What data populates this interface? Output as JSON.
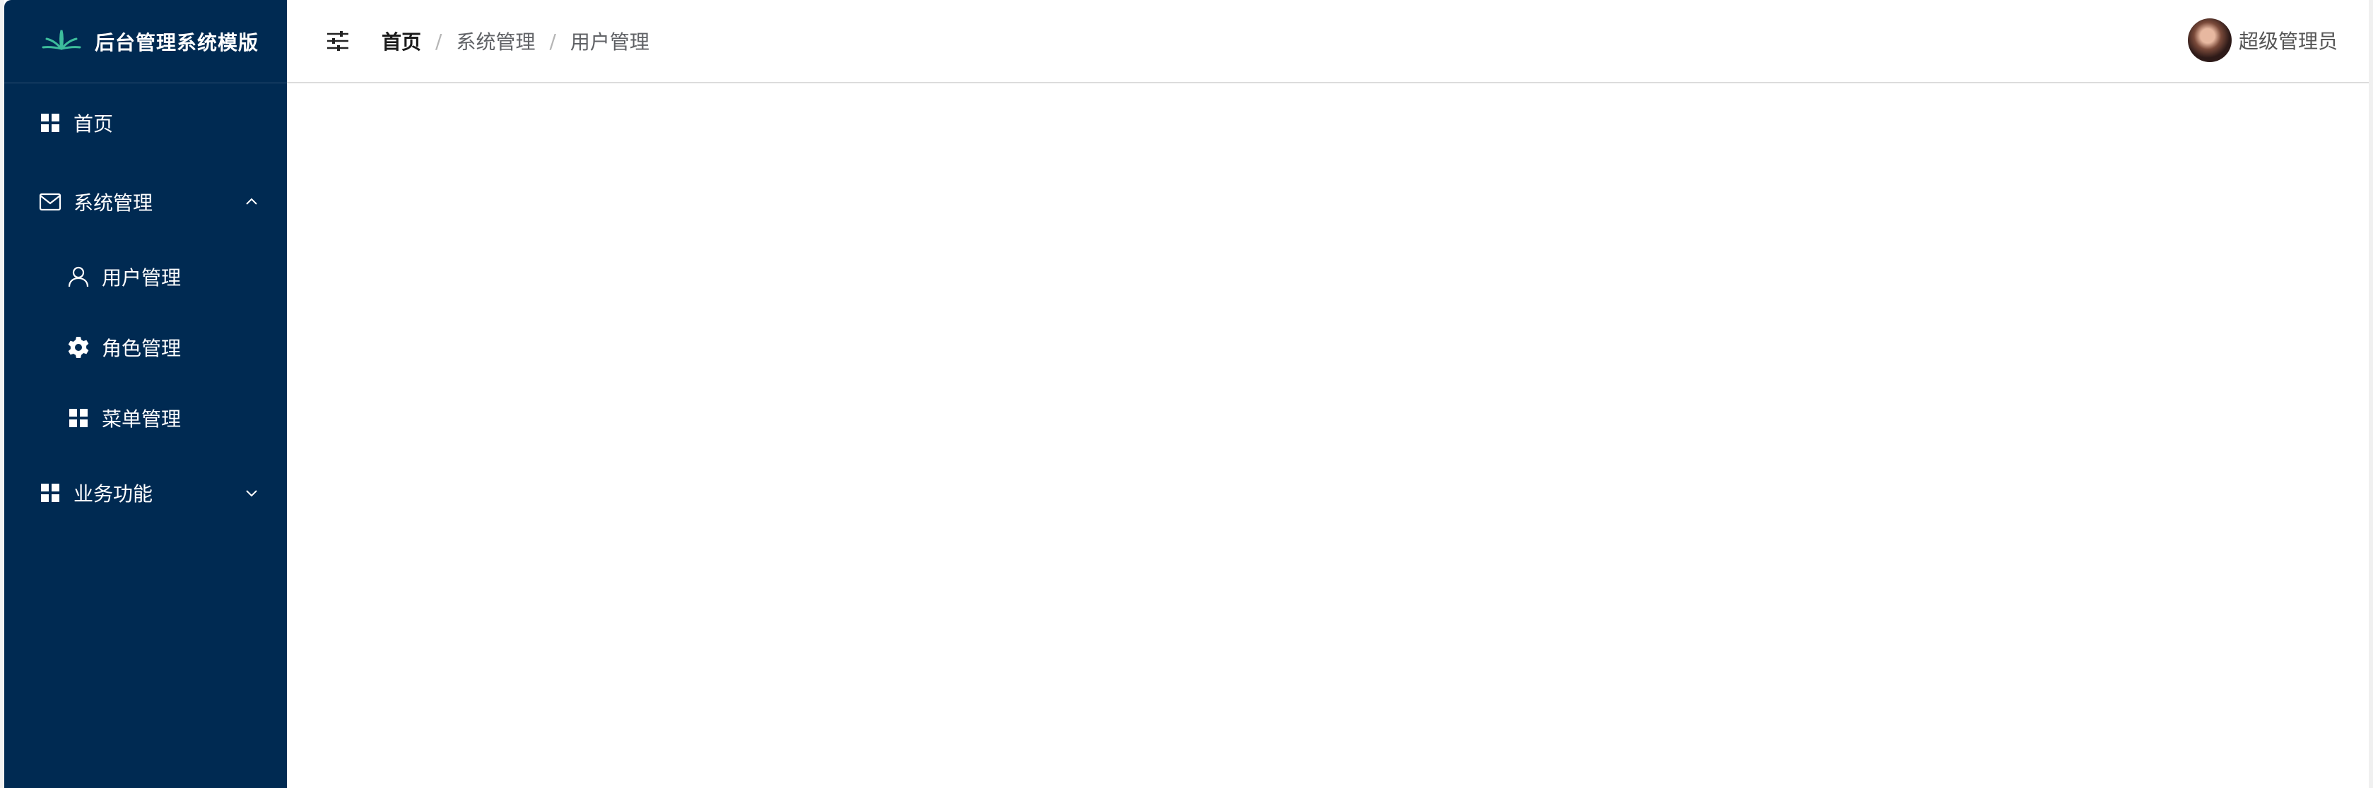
{
  "brand": {
    "title": "后台管理系统模版",
    "logo_icon": "lotus-icon",
    "logo_color": "#3dbd9c"
  },
  "sidebar": {
    "background": "#002a52",
    "items": [
      {
        "label": "首页",
        "icon": "grid-icon"
      },
      {
        "label": "系统管理",
        "icon": "mail-icon",
        "expanded": true,
        "children": [
          {
            "label": "用户管理",
            "icon": "user-icon"
          },
          {
            "label": "角色管理",
            "icon": "gear-icon"
          },
          {
            "label": "菜单管理",
            "icon": "grid-icon"
          }
        ]
      },
      {
        "label": "业务功能",
        "icon": "grid-icon",
        "expanded": false
      }
    ]
  },
  "header": {
    "toggle_icon": "sliders-icon",
    "breadcrumb": [
      "首页",
      "系统管理",
      "用户管理"
    ],
    "separator": "/",
    "user": {
      "name": "超级管理员",
      "avatar": "avatar-photo"
    }
  }
}
